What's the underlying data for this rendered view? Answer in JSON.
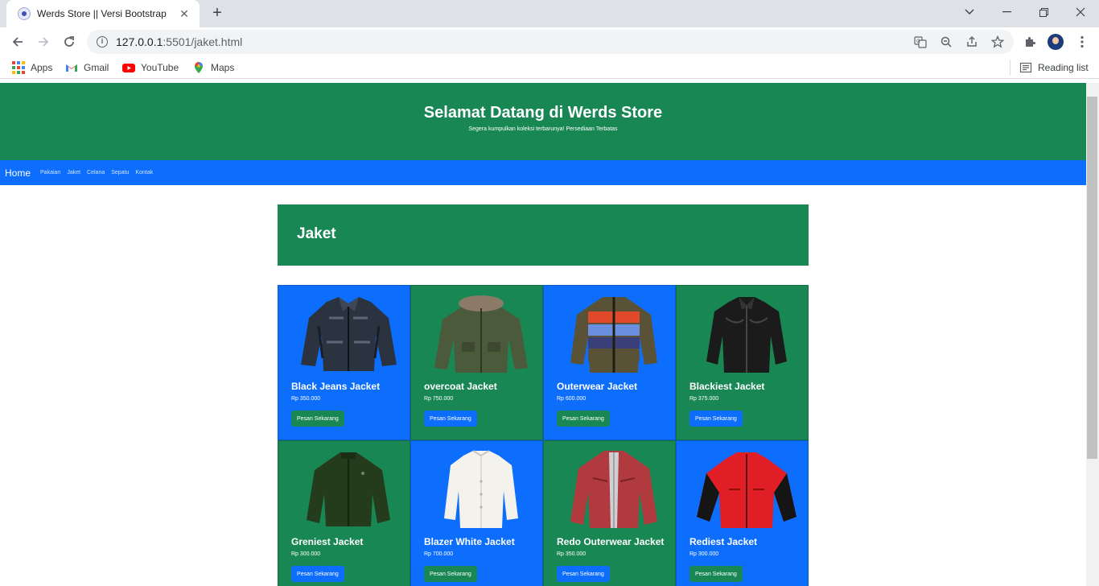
{
  "browser": {
    "tab_title": "Werds Store || Versi Bootstrap",
    "url_host": "127.0.0.1",
    "url_rest": ":5501/jaket.html",
    "bookmarks": [
      {
        "label": "Apps",
        "icon": "apps-grid-icon"
      },
      {
        "label": "Gmail",
        "icon": "gmail-icon"
      },
      {
        "label": "YouTube",
        "icon": "youtube-icon"
      },
      {
        "label": "Maps",
        "icon": "maps-icon"
      }
    ],
    "reading_list": "Reading list"
  },
  "hero": {
    "title": "Selamat Datang di Werds Store",
    "subtitle": "Segera kumpulkan koleksi terbarunya! Persediaan Terbatas"
  },
  "nav": {
    "brand": "Home",
    "links": [
      "Pakaian",
      "Jaket",
      "Celana",
      "Sepatu",
      "Kontak"
    ]
  },
  "section": {
    "title": "Jaket"
  },
  "button_label": "Pesan Sekarang",
  "colors": {
    "green": "#198754",
    "blue": "#0d6efd"
  },
  "products": [
    {
      "name": "Black Jeans Jacket",
      "price": "Rp 350.000",
      "card": "blue",
      "jacket": "denim"
    },
    {
      "name": "overcoat Jacket",
      "price": "Rp 750.000",
      "card": "green",
      "jacket": "parka"
    },
    {
      "name": "Outerwear Jacket",
      "price": "Rp 600.000",
      "card": "blue",
      "jacket": "puffer"
    },
    {
      "name": "Blackiest Jacket",
      "price": "Rp 375.000",
      "card": "green",
      "jacket": "leather"
    },
    {
      "name": "Greniest Jacket",
      "price": "Rp 300.000",
      "card": "green",
      "jacket": "softshell"
    },
    {
      "name": "Blazer White Jacket",
      "price": "Rp 700.000",
      "card": "blue",
      "jacket": "blazer"
    },
    {
      "name": "Redo Outerwear Jacket",
      "price": "Rp 350.000",
      "card": "green",
      "jacket": "red-leather"
    },
    {
      "name": "Rediest Jacket",
      "price": "Rp 300.000",
      "card": "blue",
      "jacket": "red-sport"
    }
  ]
}
